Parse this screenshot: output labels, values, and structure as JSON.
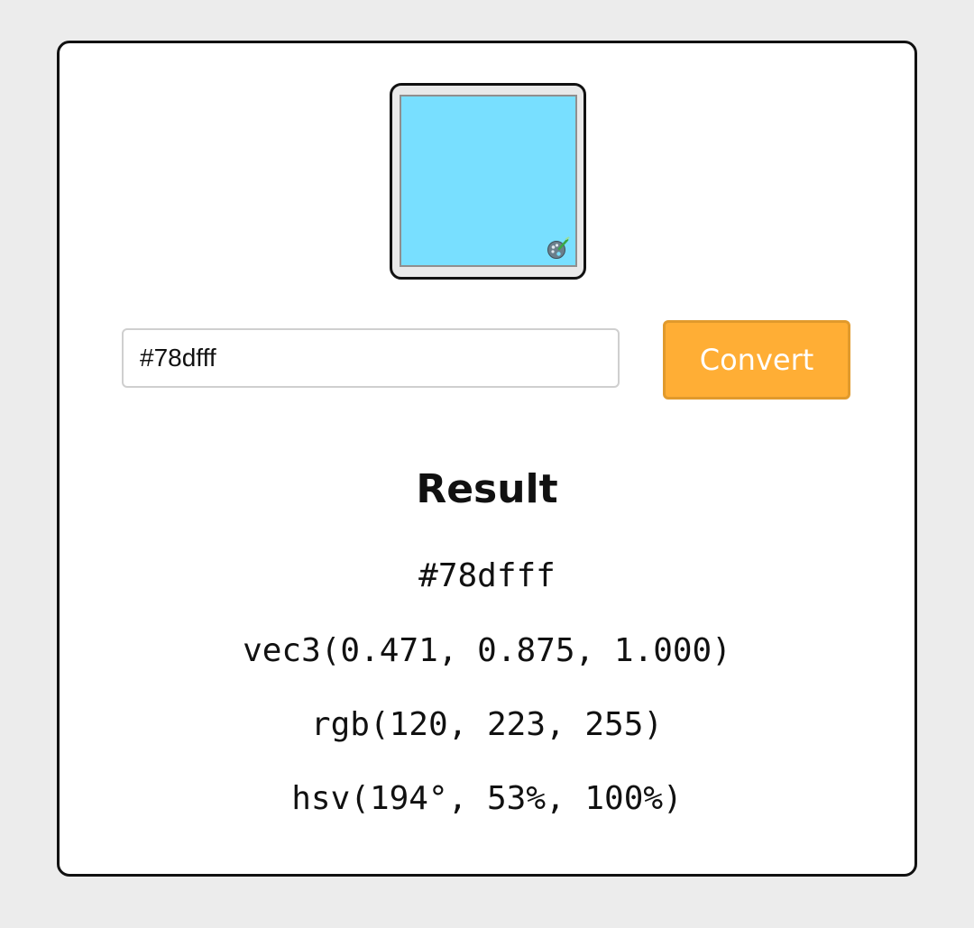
{
  "picker": {
    "color": "#78dfff",
    "icon": "palette-icon"
  },
  "input": {
    "value": "#78dfff"
  },
  "convert_button": {
    "label": "Convert",
    "color": "#ffae35"
  },
  "result": {
    "title": "Result",
    "hex": "#78dfff",
    "vec3": "vec3(0.471, 0.875, 1.000)",
    "rgb": "rgb(120, 223, 255)",
    "hsv": "hsv(194°, 53%, 100%)"
  }
}
